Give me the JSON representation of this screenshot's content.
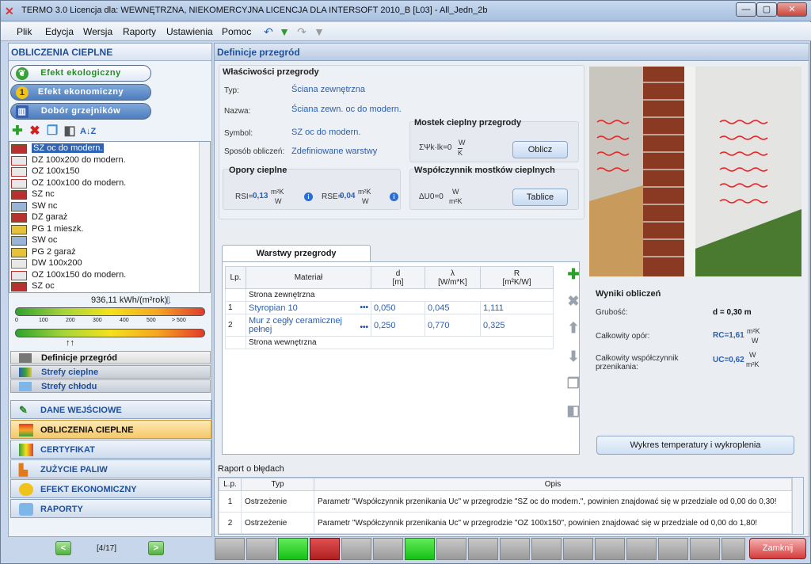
{
  "window": {
    "title": "TERMO 3.0 Licencja dla: WEWNĘTRZNA, NIEKOMERCYJNA LICENCJA DLA INTERSOFT 2010_B [L03] - All_Jedn_2b"
  },
  "menu": [
    "Plik",
    "Edycja",
    "Wersja",
    "Raporty",
    "Ustawienia",
    "Pomoc"
  ],
  "left": {
    "header": "OBLICZENIA CIEPLNE",
    "pill_buttons": [
      "Efekt ekologiczny",
      "Efekt ekonomiczny",
      "Dobór grzejników"
    ],
    "tree": [
      "SZ oc do modern.",
      "DZ 100x200 do modern.",
      "OZ 100x150",
      "OZ 100x100 do modern.",
      "SZ nc",
      "SW nc",
      "DZ garaż",
      "PG 1 mieszk.",
      "SW oc",
      "PG 2 garaż",
      "DW 100x200",
      "OZ 100x150 do modern.",
      "SZ oc"
    ],
    "energy_value": "936,11 kWh/(m²rok)",
    "energy_ticks": [
      "0",
      "100",
      "200",
      "300",
      "400",
      "500",
      "> 500"
    ],
    "subtabs": [
      "Definicje przegród",
      "Strefy cieplne",
      "Strefy chłodu"
    ],
    "nav": [
      "DANE WEJŚCIOWE",
      "OBLICZENIA CIEPLNE",
      "CERTYFIKAT",
      "ZUŻYCIE PALIW",
      "EFEKT EKONOMICZNY",
      "RAPORTY"
    ],
    "page": "[4/17]"
  },
  "main": {
    "header": "Definicje przegród",
    "props": {
      "title": "Właściwości przegrody",
      "typ_label": "Typ:",
      "typ": "Ściana zewnętrzna",
      "nazwa_label": "Nazwa:",
      "nazwa": "Ściana zewn. oc do modern.",
      "symbol_label": "Symbol:",
      "symbol": "SZ oc do modern.",
      "sposob_label": "Sposób obliczeń:",
      "sposob": "Zdefiniowane warstwy"
    },
    "mostek": {
      "title": "Mostek cieplny przegrody",
      "formula": "ΣΨk·lk=0",
      "unit_top": "W",
      "unit_bot": "K",
      "button": "Oblicz"
    },
    "opory": {
      "title": "Opory cieplne",
      "rsi_label": "RSI=",
      "rsi": "0,13",
      "rse_label": "RSE=",
      "rse": "0,04",
      "unit_top": "m²K",
      "unit_bot": "W"
    },
    "wsp": {
      "title": "Współczynnik mostków cieplnych",
      "formula": "ΔU0=0",
      "unit_top": "W",
      "unit_bot": "m²K",
      "button": "Tablice"
    },
    "layers": {
      "tab": "Warstwy przegrody",
      "headers": [
        "Lp.",
        "Materiał",
        "d\n[m]",
        "λ\n[W/m*K]",
        "R\n[m²K/W]"
      ],
      "outside": "Strona zewnętrzna",
      "inside": "Strona wewnętrzna",
      "rows": [
        {
          "lp": "1",
          "mat": "Styropian 10",
          "d": "0,050",
          "l": "0,045",
          "r": "1,111"
        },
        {
          "lp": "2",
          "mat": "Mur z cegły ceramicznej pełnej",
          "d": "0,250",
          "l": "0,770",
          "r": "0,325"
        }
      ],
      "ellipsis": "•••"
    },
    "results": {
      "title": "Wyniki obliczeń",
      "grubosc_label": "Grubość:",
      "grubosc": "d = 0,30 m",
      "opor_label": "Całkowity opór:",
      "opor": "RC=1,61",
      "opor_unit_top": "m²K",
      "opor_unit_bot": "W",
      "wsp_label": "Całkowity współczynnik przenikania:",
      "wsp": "UC=0,62",
      "wsp_unit_top": "W",
      "wsp_unit_bot": "m²K",
      "chart_button": "Wykres temperatury i wykroplenia"
    },
    "report": {
      "title": "Raport o błędach",
      "headers": [
        "L.p.",
        "Typ",
        "Opis"
      ],
      "rows": [
        {
          "lp": "1",
          "typ": "Ostrzeżenie",
          "opis": "Parametr \"Współczynnik przenikania Uc\" w przegrodzie \"SZ oc do modern.\", powinien znajdować się w przedziale od 0,00 do 0,30!"
        },
        {
          "lp": "2",
          "typ": "Ostrzeżenie",
          "opis": "Parametr \"Współczynnik przenikania Uc\" w przegrodzie \"OZ 100x150\", powinien znajdować się w przedziale od 0,00 do 1,80!"
        }
      ]
    }
  },
  "status": {
    "close": "Zamknij"
  }
}
